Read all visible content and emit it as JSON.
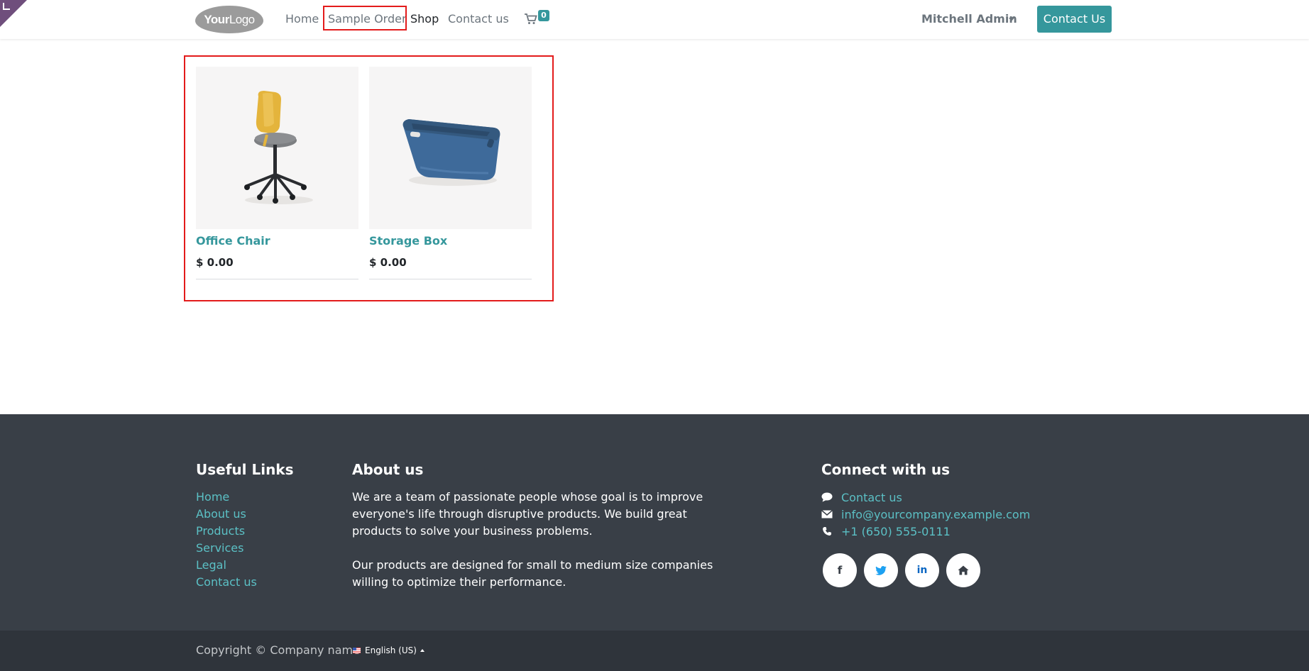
{
  "header": {
    "logo": {
      "text_bold": "Your",
      "text_light": "Logo"
    },
    "nav": [
      {
        "label": "Home"
      },
      {
        "label": "Sample Order"
      },
      {
        "label": "Shop"
      },
      {
        "label": "Contact us"
      }
    ],
    "cart": {
      "icon": "cart-icon",
      "count": "0"
    },
    "user": {
      "name": "Mitchell Admin"
    },
    "cta": {
      "label": "Contact Us"
    }
  },
  "products": [
    {
      "name": "Office Chair",
      "price": "$ 0.00",
      "image": "office-chair-image"
    },
    {
      "name": "Storage Box",
      "price": "$ 0.00",
      "image": "storage-box-image"
    }
  ],
  "footer": {
    "useful_links": {
      "title": "Useful Links",
      "items": [
        "Home",
        "About us",
        "Products",
        "Services",
        "Legal",
        "Contact us"
      ]
    },
    "about": {
      "title": "About us",
      "paragraphs": [
        "We are a team of passionate people whose goal is to improve everyone's life through disruptive products. We build great products to solve your business problems.",
        "Our products are designed for small to medium size companies willing to optimize their performance."
      ]
    },
    "connect": {
      "title": "Connect with us",
      "items": [
        {
          "icon": "comment-icon",
          "label": "Contact us"
        },
        {
          "icon": "envelope-icon",
          "label": "info@yourcompany.example.com"
        },
        {
          "icon": "phone-icon",
          "label": "+1 (650) 555-0111"
        }
      ],
      "social": [
        {
          "icon": "facebook-icon",
          "glyph": "f"
        },
        {
          "icon": "twitter-icon",
          "glyph": "t"
        },
        {
          "icon": "linkedin-icon",
          "glyph": "in"
        },
        {
          "icon": "home-icon",
          "glyph": "⌂"
        }
      ]
    }
  },
  "bottom_bar": {
    "copyright": "Copyright © Company name",
    "language": "English (US)"
  },
  "colors": {
    "accent": "#35979c",
    "footer_bg": "#393f47",
    "copyright_bg": "#2f343b",
    "highlight": "#e31b1b"
  }
}
